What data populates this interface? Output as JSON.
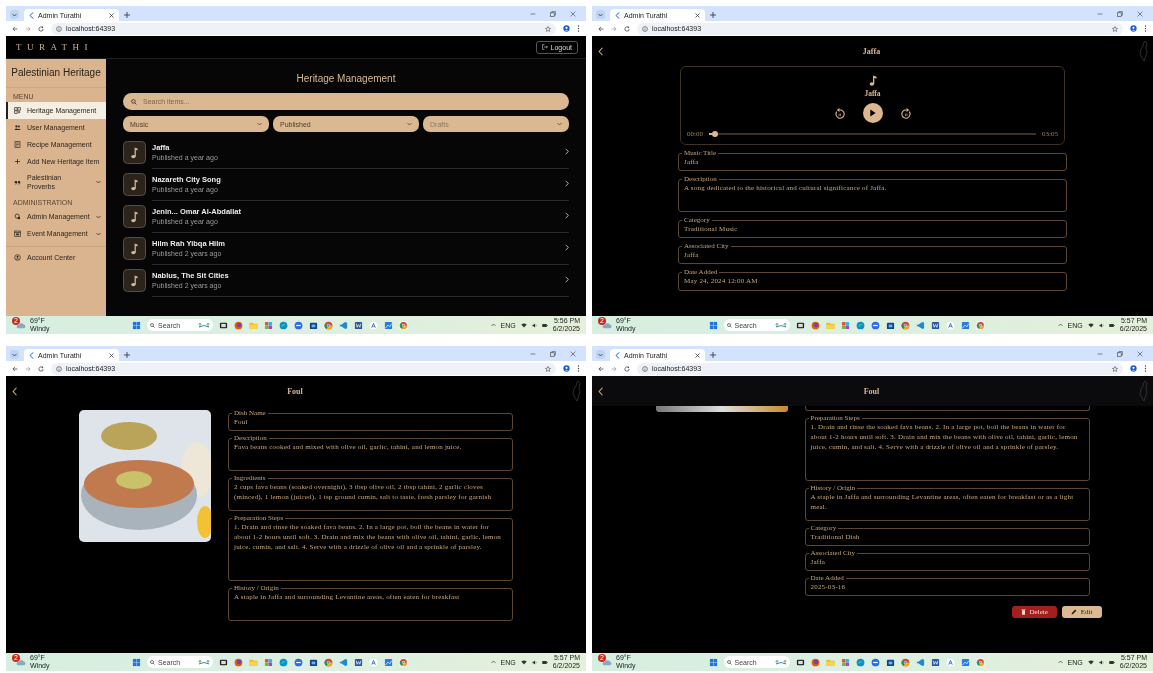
{
  "windows": [
    {
      "tab_title": "Admin Turathi",
      "url": "localhost:64393",
      "screen": {
        "kind": "admin_list",
        "brand": "TURATHI",
        "logout": "Logout",
        "sidebar": {
          "title": "Palestinian Heritage",
          "sections": [
            {
              "label": "MENU",
              "items": [
                {
                  "label": "Heritage Management",
                  "kind": "link",
                  "selected": true
                },
                {
                  "label": "User Management",
                  "kind": "link",
                  "selected": false
                },
                {
                  "label": "Recipe Management",
                  "kind": "link",
                  "selected": false
                },
                {
                  "label": "Add New Heritage Item",
                  "kind": "link",
                  "selected": false
                },
                {
                  "label": "Palestinian Proverbs",
                  "kind": "group",
                  "selected": false,
                  "expanded": false
                }
              ]
            },
            {
              "label": "ADMINISTRATION",
              "items": [
                {
                  "label": "Admin Management",
                  "kind": "group",
                  "selected": false,
                  "expanded": false
                },
                {
                  "label": "Event Management",
                  "kind": "group",
                  "selected": false,
                  "expanded": false
                }
              ]
            },
            {
              "items": [
                {
                  "label": "Account Center",
                  "kind": "link",
                  "selected": false
                }
              ]
            }
          ]
        },
        "title": "Heritage Management",
        "search": {
          "placeholder": "Search items..."
        },
        "filters": [
          {
            "value": "Music"
          },
          {
            "value": "Published"
          },
          {
            "placeholder": "Drafts"
          }
        ],
        "items": [
          {
            "title": "Jaffa",
            "subtitle": "Published a year ago"
          },
          {
            "title": "Nazareth City Song",
            "subtitle": "Published a year ago"
          },
          {
            "title": "Jenin... Omar Al-Abdallat",
            "subtitle": "Published a year ago"
          },
          {
            "title": "Hilm Rah Yibqa Hilm",
            "subtitle": "Published 2 years ago"
          },
          {
            "title": "Nablus, The Sit Cities",
            "subtitle": "Published 2 years ago"
          }
        ]
      },
      "taskbar": {
        "alerts": "2",
        "temperature": "69°F",
        "condition": "Windy",
        "search_label": "Search",
        "language": "ENG",
        "time": "5:56 PM",
        "date": "6/2/2025"
      }
    },
    {
      "tab_title": "Admin Turathi",
      "url": "localhost:64393",
      "screen": {
        "kind": "music_detail",
        "title": "Jaffa",
        "player": {
          "title": "Jaffa",
          "playing": false,
          "level": 0.02,
          "elapsed": "00:00",
          "duration": "03:05"
        },
        "fields": [
          {
            "label": "Music Title",
            "value": "Jaffa",
            "kind": "line"
          },
          {
            "label": "Description",
            "value": "A song dedicated to the historical and cultural significance of Jaffa.",
            "kind": "box"
          },
          {
            "label": "Category",
            "value": "Traditional Music",
            "kind": "line"
          },
          {
            "label": "Associated City",
            "value": "Jaffa",
            "kind": "line"
          },
          {
            "label": "Date Added",
            "value": "May 24, 2024 12:00 AM",
            "kind": "line"
          }
        ]
      },
      "taskbar": {
        "alerts": "2",
        "temperature": "69°F",
        "condition": "Windy",
        "search_label": "Search",
        "language": "ENG",
        "time": "5:57 PM",
        "date": "6/2/2025"
      }
    },
    {
      "tab_title": "Admin Turathi",
      "url": "localhost:64393",
      "screen": {
        "kind": "dish_detail",
        "title": "Foul",
        "photo_cropped": false,
        "fields": [
          {
            "label": "Dish Name",
            "value": "Foul",
            "kind": "line"
          },
          {
            "label": "Description",
            "value": "Fava beans cooked and mixed with olive oil, garlic, tahini, and lemon juice.",
            "kind": "box"
          },
          {
            "label": "Ingredients",
            "value": "2 cups fava beans (soaked overnight), 3 tbsp olive oil, 2 tbsp tahini, 2 garlic cloves (minced), 1 lemon (juiced), 1 tsp ground cumin, salt to taste, fresh parsley for garnish",
            "kind": "box"
          },
          {
            "label": "Preparation Steps",
            "value": "1. Drain and rinse the soaked fava beans. 2. In a large pot, boil the beans in water for about 1-2 hours until soft. 3. Drain and mix the beans with olive oil, tahini, garlic, lemon juice, cumin, and salt. 4. Serve with a drizzle of olive oil and a sprinkle of parsley.",
            "kind": "large_box"
          },
          {
            "label": "History / Origin",
            "value": "A staple in Jaffa and surrounding Levantine areas, often eaten for breakfast",
            "kind": "box"
          }
        ]
      },
      "taskbar": {
        "alerts": "2",
        "temperature": "69°F",
        "condition": "Windy",
        "search_label": "Search",
        "language": "ENG",
        "time": "5:57 PM",
        "date": "6/2/2025"
      }
    },
    {
      "tab_title": "Admin Turathi",
      "url": "localhost:64393",
      "screen": {
        "kind": "dish_detail",
        "title": "Foul",
        "photo_cropped": true,
        "fields": [
          {
            "label": "Preparation Steps",
            "value": "1. Drain and rinse the soaked fava beans. 2. In a large pot, boil the beans in water for about 1-2 hours until soft. 3. Drain and mix the beans with olive oil, tahini, garlic, lemon juice, cumin, and salt. 4. Serve with a drizzle of olive oil and a sprinkle of parsley.",
            "kind": "large_box"
          },
          {
            "label": "History / Origin",
            "value": "A staple in Jaffa and surrounding Levantine areas, often eaten for breakfast or as a light meal.",
            "kind": "box"
          },
          {
            "label": "Category",
            "value": "Traditional Dish",
            "kind": "line"
          },
          {
            "label": "Associated City",
            "value": "Jaffa",
            "kind": "line"
          },
          {
            "label": "Date Added",
            "value": "2025-03-16",
            "kind": "line"
          }
        ],
        "actions": [
          {
            "label": "Delete",
            "kind": "danger"
          },
          {
            "label": "Edit",
            "kind": "primary"
          }
        ]
      },
      "taskbar": {
        "alerts": "2",
        "temperature": "69°F",
        "condition": "Windy",
        "search_label": "Search",
        "language": "ENG",
        "time": "5:57 PM",
        "date": "6/2/2025"
      }
    }
  ]
}
